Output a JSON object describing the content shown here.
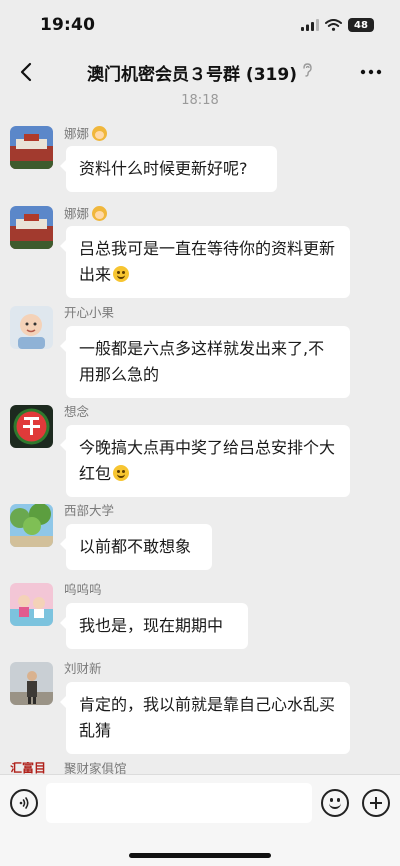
{
  "status_bar": {
    "time": "19:40",
    "battery": "48",
    "icons": [
      "signal-icon",
      "wifi-icon",
      "battery-icon"
    ]
  },
  "nav": {
    "title": "澳门机密会员３号群 (319)",
    "icons": [
      "back-arrow-icon",
      "ear-icon",
      "more-icon"
    ]
  },
  "chat": {
    "timestamp": "18:18",
    "messages": [
      {
        "sender": "娜娜",
        "text": "资料什么时候更新好呢?",
        "emoji": "",
        "avatar": "palace-photo"
      },
      {
        "sender": "娜娜",
        "text": "吕总我可是一直在等待你的资料更新出来",
        "emoji": "smile",
        "avatar": "palace-photo"
      },
      {
        "sender": "开心小果",
        "text": "一般都是六点多这样就发出来了,不用那么急的",
        "emoji": "",
        "avatar": "baby-photo"
      },
      {
        "sender": "想念",
        "text": "今晚搞大点再中奖了给吕总安排个大红包",
        "emoji": "grin",
        "avatar": "watermelon-photo"
      },
      {
        "sender": "西部大学",
        "text": "以前都不敢想象",
        "emoji": "",
        "avatar": "trees-photo"
      },
      {
        "sender": "呜呜呜",
        "text": "我也是，现在期期中",
        "emoji": "",
        "avatar": "pink-photo"
      },
      {
        "sender": "刘财新",
        "text": "肯定的，我以前就是靠自己心水乱买乱猜",
        "emoji": "",
        "avatar": "man-photo"
      },
      {
        "sender": "聚财家俱馆",
        "text": "",
        "emoji": "",
        "avatar": "logo-text"
      }
    ],
    "partial_avatar_text": "汇富目"
  },
  "colors": {
    "background": "#ededed",
    "bubble": "#ffffff",
    "sender_text": "#7a7a7a",
    "timestamp_text": "#9a9a9a",
    "partial_avatar_text": "#b0201a"
  },
  "input_bar": {
    "placeholder": "",
    "icons": [
      "voice-icon",
      "emoji-icon",
      "plus-icon"
    ]
  }
}
